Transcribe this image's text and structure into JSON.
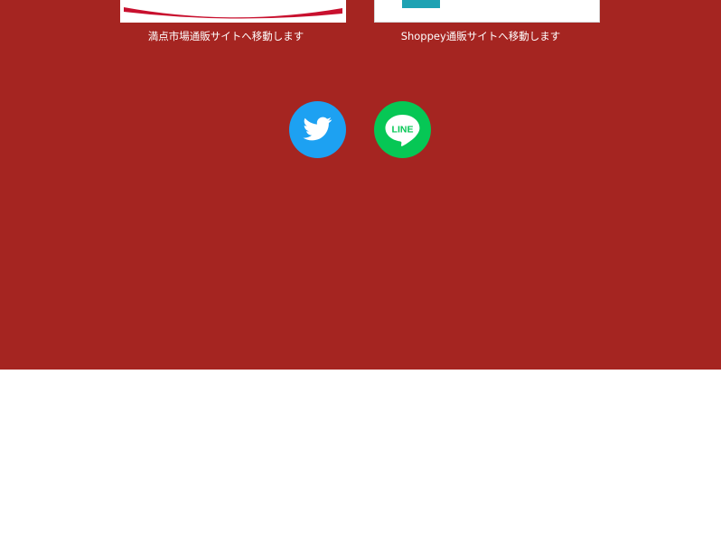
{
  "footer": {
    "background_color": "#a52521",
    "shops": [
      {
        "caption": "満点市場通販サイトへ移動します",
        "accent_color": "#c8102e"
      },
      {
        "caption": "Shoppey通販サイトへ移動します",
        "accent_color": "#1ea2b3"
      }
    ],
    "social": {
      "twitter": {
        "icon": "twitter-bird-icon",
        "color": "#1da1f2"
      },
      "line": {
        "icon": "line-logo-icon",
        "label": "LINE",
        "color": "#06c755"
      }
    }
  }
}
